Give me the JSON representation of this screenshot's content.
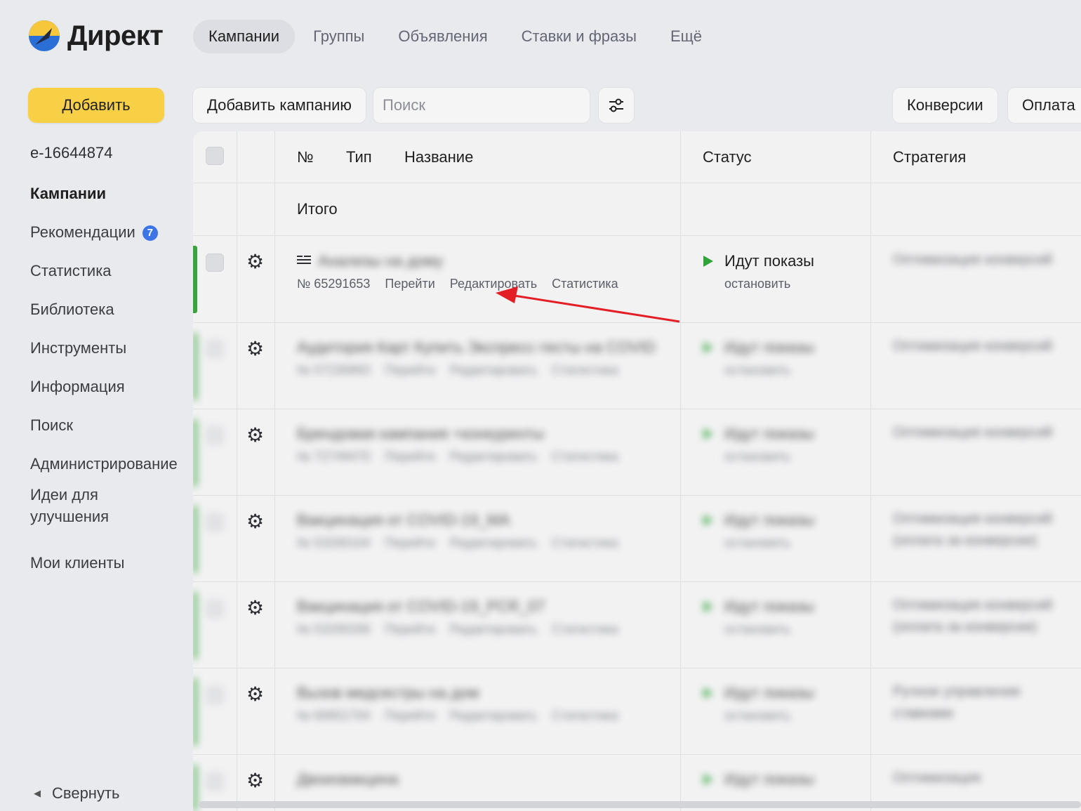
{
  "brand": {
    "name": "Директ"
  },
  "topnav": {
    "tabs": [
      {
        "label": "Кампании",
        "active": true
      },
      {
        "label": "Группы"
      },
      {
        "label": "Объявления"
      },
      {
        "label": "Ставки и фразы"
      },
      {
        "label": "Ещё"
      }
    ]
  },
  "sidebar": {
    "add_label": "Добавить",
    "login": "e-16644874",
    "items": [
      {
        "label": "Кампании",
        "active": true
      },
      {
        "label": "Рекомендации",
        "badge": "7"
      },
      {
        "label": "Статистика"
      },
      {
        "label": "Библиотека"
      },
      {
        "label": "Инструменты"
      },
      {
        "label": "Информация"
      },
      {
        "label": "Поиск"
      },
      {
        "label": "Администрирование"
      },
      {
        "label": "Идеи для улучшения"
      },
      {
        "label": "Мои клиенты"
      }
    ],
    "collapse_label": "Свернуть"
  },
  "toolbar": {
    "add_campaign": "Добавить кампанию",
    "search_placeholder": "Поиск",
    "conversions": "Конверсии",
    "payment": "Оплата"
  },
  "table": {
    "headers": {
      "number": "№",
      "type": "Тип",
      "name": "Название",
      "status": "Статус",
      "strategy": "Стратегия"
    },
    "total_label": "Итого",
    "rows": [
      {
        "title": "Анализы на дому",
        "number": "№ 65291653",
        "links": [
          "Перейти",
          "Редактировать",
          "Статистика"
        ],
        "status": "Идут показы",
        "status_action": "остановить",
        "strategy": "Оптимизация конверсий",
        "blurred_title": true
      },
      {
        "title": "Аудитория Карт Купить Экспресс-тесты на COVID",
        "number": "№ 57230893",
        "links": [
          "Перейти",
          "Редактировать",
          "Статистика"
        ],
        "status": "Идут показы",
        "status_action": "остановить",
        "strategy": "Оптимизация конверсий",
        "blurred": true
      },
      {
        "title": "Брендовая кампания +конкуренты",
        "number": "№ 72749470",
        "links": [
          "Перейти",
          "Редактировать",
          "Статистика"
        ],
        "status": "Идут показы",
        "status_action": "остановить",
        "strategy": "Оптимизация конверсий",
        "blurred": true
      },
      {
        "title": "Вакцинация от COVID-19_МА",
        "number": "№ 53200104",
        "links": [
          "Перейти",
          "Редактировать",
          "Статистика"
        ],
        "status": "Идут показы",
        "status_action": "остановить",
        "strategy": "Оптимизация конверсий (оплата за конверсии)",
        "blurred": true
      },
      {
        "title": "Вакцинация от COVID-19_PCR_07",
        "number": "№ 53200206",
        "links": [
          "Перейти",
          "Редактировать",
          "Статистика"
        ],
        "status": "Идут показы",
        "status_action": "остановить",
        "strategy": "Оптимизация конверсий (оплата за конверсии)",
        "blurred": true
      },
      {
        "title": "Вызов медсестры на дом",
        "number": "№ 60651704",
        "links": [
          "Перейти",
          "Редактировать",
          "Статистика"
        ],
        "status": "Идут показы",
        "status_action": "остановить",
        "strategy": "Ручное управление ставками",
        "blurred": true
      },
      {
        "title": "Двоихвакцина",
        "number": "",
        "links": [],
        "status": "Идут показы",
        "status_action": "",
        "strategy": "Оптимизация",
        "blurred": true
      }
    ]
  },
  "colors": {
    "accent_yellow": "#f8d046",
    "status_green": "#37a63a",
    "badge_blue": "#3d74e6",
    "annotation_red": "#e31e24"
  }
}
